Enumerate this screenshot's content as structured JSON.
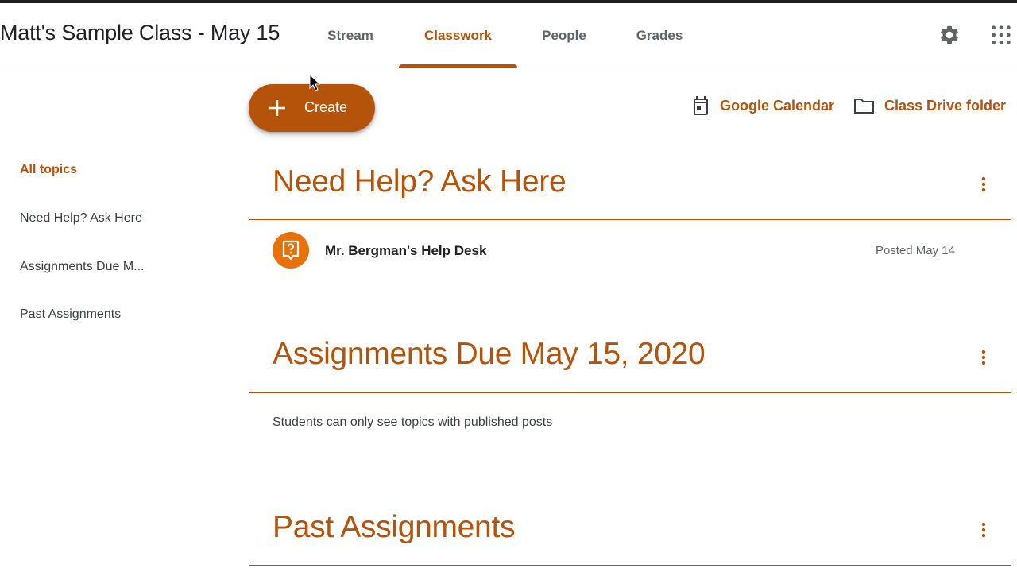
{
  "header": {
    "class_title": "Matt's Sample Class - May 15",
    "tabs": [
      {
        "label": "Stream"
      },
      {
        "label": "Classwork"
      },
      {
        "label": "People"
      },
      {
        "label": "Grades"
      }
    ],
    "active_tab": "Classwork"
  },
  "toolbar": {
    "create_label": "Create",
    "calendar_label": "Google Calendar",
    "drive_label": "Class Drive folder"
  },
  "sidebar": {
    "items": [
      {
        "label": "All topics"
      },
      {
        "label": "Need Help? Ask Here"
      },
      {
        "label": "Assignments Due M..."
      },
      {
        "label": "Past Assignments"
      }
    ]
  },
  "topics": [
    {
      "title": "Need Help? Ask Here",
      "items": [
        {
          "title": "Mr. Bergman's Help Desk",
          "posted": "Posted May 14",
          "icon": "question-icon"
        }
      ]
    },
    {
      "title": "Assignments Due May 15, 2020",
      "note": "Students can only see topics with published posts"
    },
    {
      "title": "Past Assignments"
    }
  ],
  "colors": {
    "accent": "#b45309",
    "item_icon_bg": "#e8710a",
    "text": "#3c4043"
  }
}
